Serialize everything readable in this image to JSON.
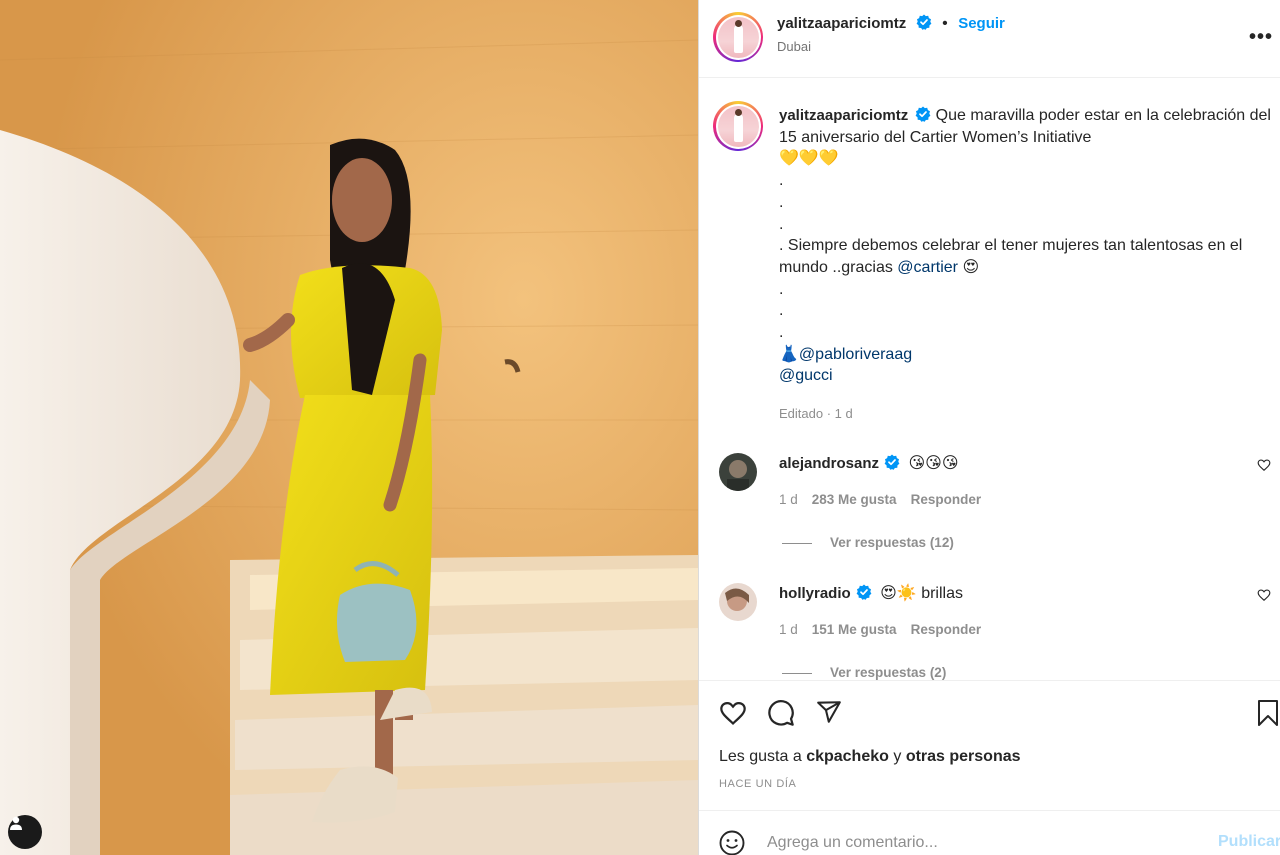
{
  "post": {
    "author": "yalitzaapariciomtz",
    "location": "Dubai",
    "follow_label": "Seguir",
    "more_label": "•••"
  },
  "caption": {
    "author": "yalitzaapariciomtz",
    "line1": "Que maravilla poder estar en la celebración del 15 aniversario del Cartier Women’s Initiative",
    "hearts": "💛💛💛",
    "dot": ".",
    "line2": ". Siempre debemos celebrar el tener mujeres tan talentosas en el mundo ..gracias",
    "mention_cartier": "@cartier",
    "emoji_love": "😍",
    "dress_emoji": "👗",
    "mention_pablo": "@pabloriveraag",
    "mention_gucci": "@gucci",
    "edited": "Editado · 1 d"
  },
  "comments": [
    {
      "user": "alejandrosanz",
      "text": "😘😘😘",
      "age": "1 d",
      "likes": "283 Me gusta",
      "reply": "Responder",
      "view_replies": "Ver respuestas (12)"
    },
    {
      "user": "hollyradio",
      "text": "😍☀️ brillas",
      "age": "1 d",
      "likes": "151 Me gusta",
      "reply": "Responder",
      "view_replies": "Ver respuestas (2)"
    }
  ],
  "likes_line": {
    "prefix": "Les gusta a",
    "user": "ckpacheko",
    "connector": "y",
    "others": "otras personas"
  },
  "posted_time": "HACE UN DÍA",
  "add_comment": {
    "placeholder": "Agrega un comentario...",
    "publish_label": "Publicar"
  },
  "icons": {
    "like": "heart-icon",
    "comment": "comment-icon",
    "share": "send-icon",
    "save": "bookmark-icon",
    "emoji": "smiley-icon",
    "verified": "verified-badge-icon",
    "tag": "user-tag-icon"
  },
  "colors": {
    "link": "#0095f6",
    "mention": "#00376b",
    "verified": "#0095f6",
    "muted": "#8e8e8e"
  }
}
